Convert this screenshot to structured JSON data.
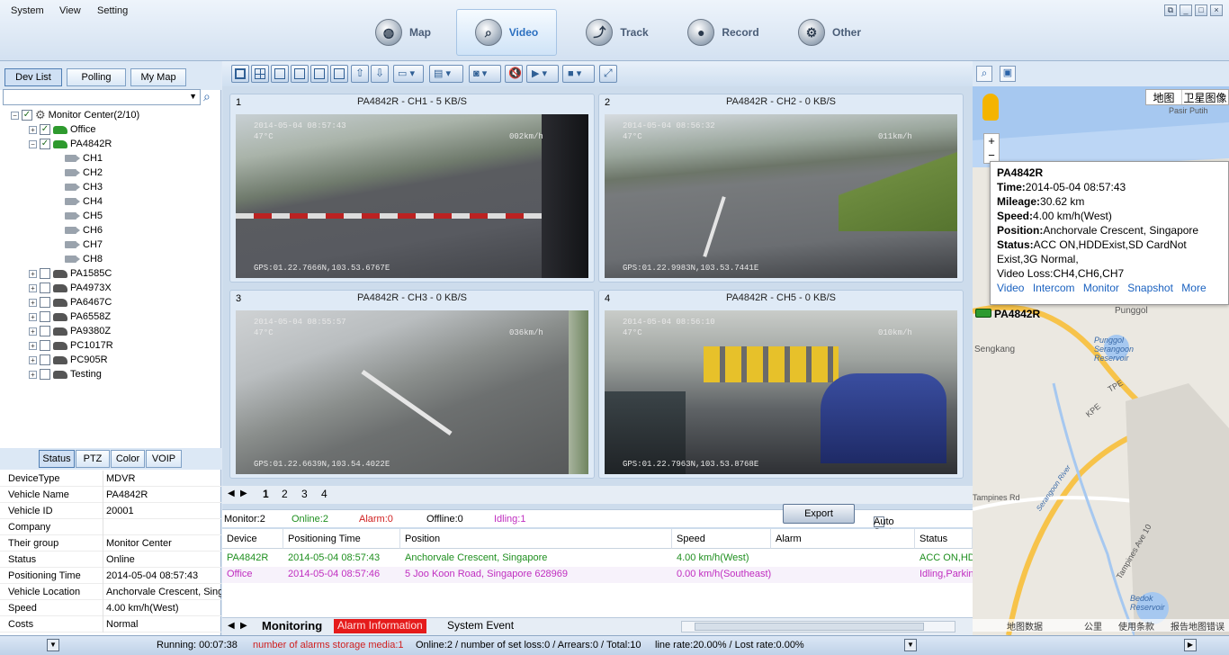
{
  "menu": [
    "System",
    "View",
    "Setting"
  ],
  "nav": [
    {
      "label": "Map",
      "icon": "globe-icon"
    },
    {
      "label": "Video",
      "icon": "magnifier-icon",
      "active": true
    },
    {
      "label": "Track",
      "icon": "track-icon"
    },
    {
      "label": "Record",
      "icon": "record-icon"
    },
    {
      "label": "Other",
      "icon": "gear-icon"
    }
  ],
  "window_buttons": [
    "restore",
    "minimize",
    "maximize",
    "close"
  ],
  "left": {
    "tabs": [
      "Dev List",
      "Polling",
      "My Map"
    ],
    "tree": {
      "root": "Monitor Center(2/10)",
      "groups": [
        {
          "name": "Office",
          "checked": true,
          "color": "#2e9a2e"
        },
        {
          "name": "PA4842R",
          "checked": true,
          "color": "#2e9a2e",
          "channels": [
            "CH1",
            "CH2",
            "CH3",
            "CH4",
            "CH5",
            "CH6",
            "CH7",
            "CH8"
          ]
        },
        {
          "name": "PA1585C",
          "checked": false,
          "color": "#555"
        },
        {
          "name": "PA4973X",
          "checked": false,
          "color": "#555"
        },
        {
          "name": "PA6467C",
          "checked": false,
          "color": "#555"
        },
        {
          "name": "PA6558Z",
          "checked": false,
          "color": "#555"
        },
        {
          "name": "PA9380Z",
          "checked": false,
          "color": "#555"
        },
        {
          "name": "PC1017R",
          "checked": false,
          "color": "#555"
        },
        {
          "name": "PC905R",
          "checked": false,
          "color": "#555"
        },
        {
          "name": "Testing",
          "checked": false,
          "color": "#555"
        }
      ]
    },
    "prop_tabs": [
      "Status",
      "PTZ",
      "Color",
      "VOIP"
    ],
    "props": [
      [
        "DeviceType",
        "MDVR"
      ],
      [
        "Vehicle Name",
        "PA4842R"
      ],
      [
        "Vehicle ID",
        "20001"
      ],
      [
        "Company",
        ""
      ],
      [
        "Their group",
        "Monitor Center"
      ],
      [
        "Status",
        "Online"
      ],
      [
        "Positioning Time",
        "2014-05-04 08:57:43"
      ],
      [
        "Vehicle Location",
        "Anchorvale Crescent, Singapore"
      ],
      [
        "Speed",
        "4.00 km/h(West)"
      ],
      [
        "Costs",
        "Normal"
      ]
    ]
  },
  "videos": [
    {
      "num": "1",
      "title": "PA4842R - CH1 - 5 KB/S",
      "ts": "2014-05-04 08:57:43",
      "temp": "47°C",
      "speed": "002km/h",
      "gps": "GPS:01.22.7666N,103.53.6767E"
    },
    {
      "num": "2",
      "title": "PA4842R - CH2 - 0 KB/S",
      "ts": "2014-05-04 08:56:32",
      "temp": "47°C",
      "speed": "011km/h",
      "gps": "GPS:01.22.9983N,103.53.7441E"
    },
    {
      "num": "3",
      "title": "PA4842R - CH3 - 0 KB/S",
      "ts": "2014-05-04 08:55:57",
      "temp": "47°C",
      "speed": "036km/h",
      "gps": "GPS:01.22.6639N,103.54.4022E"
    },
    {
      "num": "4",
      "title": "PA4842R - CH5 - 0 KB/S",
      "ts": "2014-05-04 08:56:10",
      "temp": "47°C",
      "speed": "010km/h",
      "gps": "GPS:01.22.7963N,103.53.8768E"
    }
  ],
  "pages": [
    "1",
    "2",
    "3",
    "4"
  ],
  "stats": {
    "monitor": "Monitor:2",
    "online": "Online:2",
    "alarm": "Alarm:0",
    "offline": "Offline:0",
    "idling": "Idling:1",
    "export": "Export",
    "autosort": "Auto Sort"
  },
  "grid": {
    "headers": [
      "Device",
      "Positioning Time",
      "Position",
      "Speed",
      "Alarm",
      "Status"
    ],
    "rows": [
      {
        "color": "#1f8f1f",
        "cells": [
          "PA4842R",
          "2014-05-04 08:57:43",
          "Anchorvale Crescent, Singapore",
          "4.00 km/h(West)",
          "",
          "ACC ON,HDDExist"
        ]
      },
      {
        "color": "#c02ec0",
        "cells": [
          "Office",
          "2014-05-04 08:57:46",
          "5 Joo Koon Road, Singapore 628969",
          "0.00 km/h(Southeast)",
          "",
          "Idling,Parking"
        ]
      }
    ]
  },
  "bottom_tabs": [
    "Monitoring",
    "Alarm Information",
    "System Event"
  ],
  "map": {
    "type_buttons": [
      "地图",
      "卫星图像"
    ],
    "popup": {
      "title": "PA4842R",
      "time_label": "Time:",
      "time": "2014-05-04 08:57:43",
      "mileage_label": "Mileage:",
      "mileage": "30.62 km",
      "speed_label": "Speed:",
      "speed": "4.00 km/h(West)",
      "position_label": "Position:",
      "position": "Anchorvale Crescent, Singapore",
      "status_label": "Status:",
      "status": "ACC ON,HDDExist,SD CardNot Exist,3G Normal,",
      "videoloss": "Video Loss:CH4,CH6,CH7",
      "links": [
        "Video",
        "Intercom",
        "Monitor",
        "Snapshot",
        "More"
      ]
    },
    "marker": "PA4842R",
    "places": [
      "Sengkang",
      "Punggol",
      "Punggol Serangoon Reservoir",
      "Pasir Putih",
      "TPE",
      "KPE",
      "Tampines Rd",
      "Tampines Ave 10",
      "Bedok Reservoir",
      "Serangoon River"
    ],
    "footer": [
      "地图数据",
      "公里",
      "使用条款",
      "报告地图错误"
    ]
  },
  "statusbar": {
    "running": "Running: 00:07:38",
    "alarms": "number of alarms storage media:1",
    "online": "Online:2 / number of set loss:0 / Arrears:0 / Total:10",
    "rate": "line rate:20.00% / Lost rate:0.00%"
  }
}
